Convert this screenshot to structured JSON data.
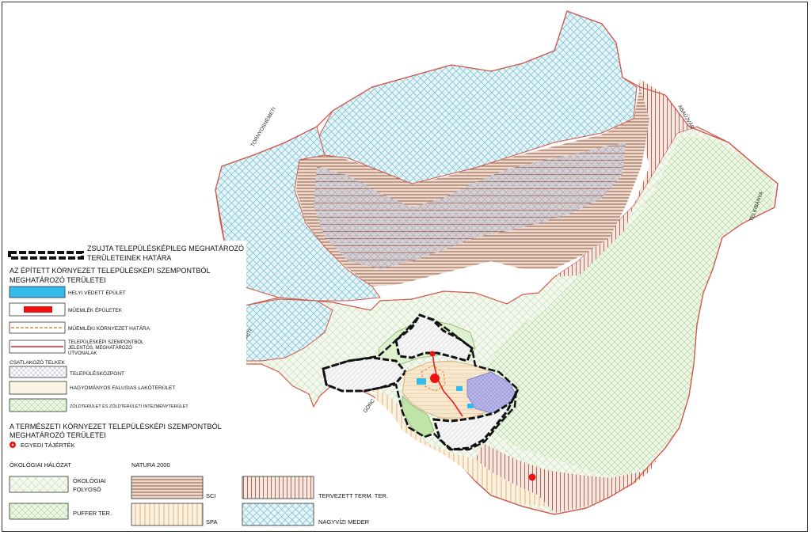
{
  "place_labels": {
    "tornyosnemeti_top": "TORNYOSNÉMETI",
    "abaujvar": "ABAÚJVÁR",
    "telkibanya": "TELKIBÁNYA",
    "tornyosnemeti_left": "TORNYOSNÉMETI",
    "gonc": "GÖNC"
  },
  "legend": {
    "boundary_label_1": "ZSUJTA TELEPÜLÉSKÉPILEG MEGHATÁROZÓ",
    "boundary_label_2": "TERÜLETEINEK HATÁRA",
    "built_heading_1": "AZ ÉPÍTETT KÖRNYEZET TELEPÜLÉSKÉPI SZEMPONTBÓL",
    "built_heading_2": "MEGHATÁROZÓ TERÜLETEI",
    "local_protected": "HELYI VÉDETT ÉPÜLET",
    "monument": "MŰEMLÉK ÉPÜLETEK",
    "monument_env": "MŰEMLÉKI KÖRNYEZET HATÁRA",
    "routes_1": "TELEPÜLÉSKÉPI SZEMPONTBÓL",
    "routes_2": "JELENTŐS, MEGHATÁROZÓ",
    "routes_3": "ÚTVONALAK",
    "attached_plots": "CSATLAKOZÓ TELKEK",
    "centre": "TELEPÜLÉSKÖZPONT",
    "traditional": "HAGYOMÁNYOS FALUSIAS LAKÓTERÜLET",
    "green": "ZÖLDTERÜLET ÉS ZÖLDTERÜLETI INTÉZMÉNYTERÜLET",
    "natural_heading_1": "A TERMÉSZETI KÖRNYEZET TELEPÜLÉSKÉPI SZEMPONTBÓL",
    "natural_heading_2": "MEGHATÁROZÓ TERÜLETEI",
    "viewpoint": "EGYEDI TÁJÉRTÉK",
    "eco_heading": "ÖKOLÓGIAI HÁLÓZAT",
    "natura_heading": "NATURA 2000",
    "eco_corridor_1": "ÖKOLÓGIAI",
    "eco_corridor_2": "FOLYOSÓ",
    "buffer": "PUFFER TER.",
    "sci": "SCI",
    "spa": "SPA",
    "planned": "TERVEZETT TERM. TER.",
    "floodbed": "NAGYVÍZI MEDER"
  },
  "colors": {
    "flood_blue": "#7fc7d9",
    "eco_green": "#b7d9a8",
    "sci_brown": "#a0522d",
    "spa_tan": "#d2a76b",
    "planned_red": "#b05a4a",
    "protected_blue": "#33bbee",
    "monument_red": "#ee1111",
    "route_red": "#d22",
    "centre_purple": "#9999dd",
    "border_red": "#d0574a"
  }
}
